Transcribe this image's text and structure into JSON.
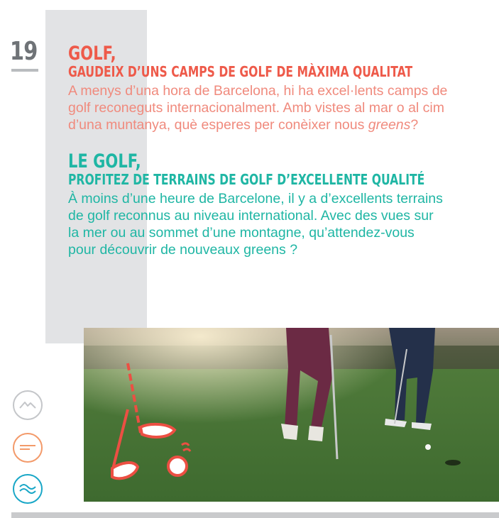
{
  "page": {
    "number": "19"
  },
  "catalan": {
    "title": "GOLF,",
    "subtitle": "GAUDEIX D’UNS CAMPS DE GOLF DE MÀXIMA QUALITAT",
    "body_lines": [
      "A menys d’una hora de Barcelona, hi ha excel·lents camps de",
      "golf reconeguts internacionalment. Amb vistes al mar o al cim",
      "d’una muntanya, què esperes per conèixer nous "
    ],
    "body_italic": "greens",
    "body_end": "?"
  },
  "french": {
    "title": "LE GOLF,",
    "subtitle": "PROFITEZ DE TERRAINS DE GOLF D’EXCELLENTE QUALITÉ",
    "body_lines": [
      "À moins d’une heure de Barcelone, il y a d’excellents terrains",
      "de golf reconnus au niveau international. Avec des vues sur",
      "la mer ou au sommet d’une montagne, qu’attendez-vous",
      "pour découvrir de nouveaux greens ?"
    ]
  },
  "side_nav": [
    {
      "icon": "mountain-wave-icon",
      "color": "#c4c6c9"
    },
    {
      "icon": "horizon-lines-icon",
      "color": "#f39a6a"
    },
    {
      "icon": "sea-waves-icon",
      "color": "#19a7c7"
    }
  ],
  "colors": {
    "catalan_title": "#ee5a4a",
    "catalan_body": "#f08a7d",
    "french_accent": "#1fb6a4",
    "gray_band": "#e2e3e5"
  }
}
